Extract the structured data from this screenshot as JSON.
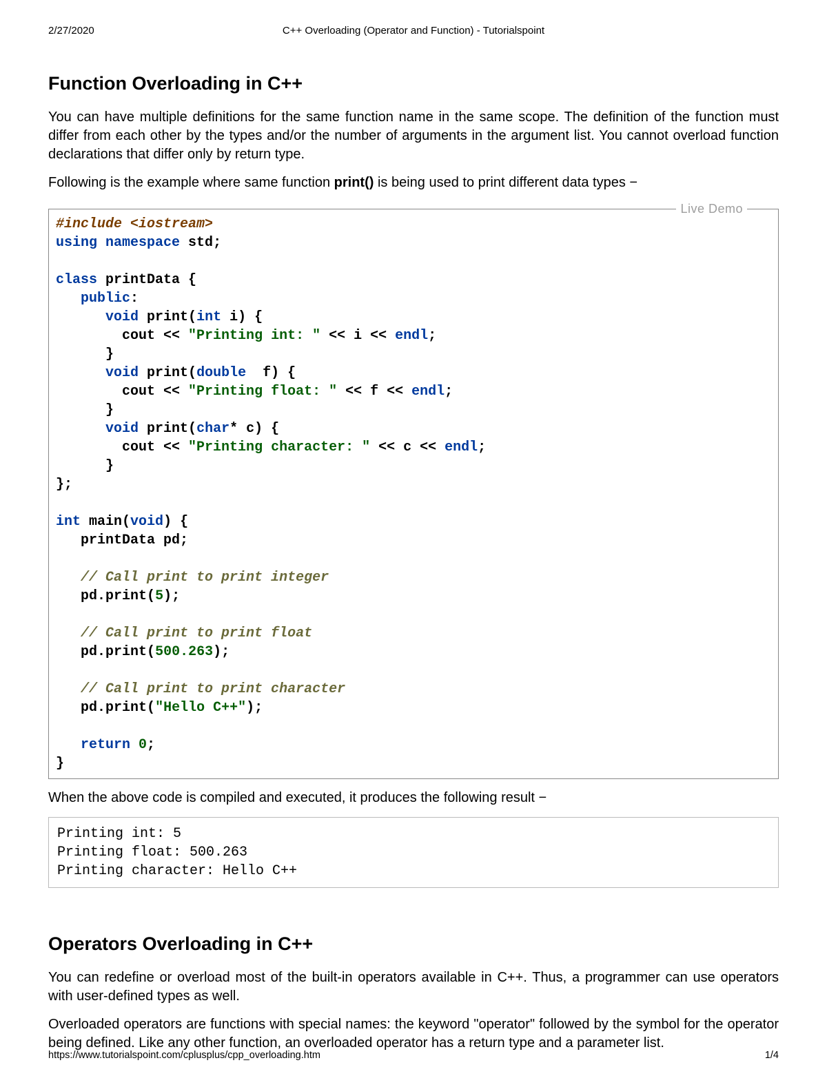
{
  "header": {
    "date": "2/27/2020",
    "title": "C++ Overloading (Operator and Function) - Tutorialspoint"
  },
  "section1": {
    "heading": "Function Overloading in C++",
    "para1": "You can have multiple definitions for the same function name in the same scope. The definition of the function must differ from each other by the types and/or the number of arguments in the argument list. You cannot overload function declarations that differ only by return type.",
    "para2_pre": "Following is the example where same function ",
    "para2_bold": "print()",
    "para2_post": " is being used to print different data types −"
  },
  "code1": {
    "live_demo": "Live Demo",
    "lines": [
      [
        [
          "#include <iostream>",
          "c-prep"
        ]
      ],
      [
        [
          "using ",
          "c-kw"
        ],
        [
          "namespace ",
          "c-kw"
        ],
        [
          "std",
          "c-ident"
        ],
        [
          ";",
          "c-punc"
        ]
      ],
      [
        [
          "",
          ""
        ]
      ],
      [
        [
          "class ",
          "c-kw"
        ],
        [
          "printData ",
          "c-ident"
        ],
        [
          "{",
          "c-punc"
        ]
      ],
      [
        [
          "   ",
          ""
        ],
        [
          "public",
          "c-kw"
        ],
        [
          ":",
          "c-punc"
        ]
      ],
      [
        [
          "      ",
          ""
        ],
        [
          "void ",
          "c-type"
        ],
        [
          "print",
          "c-ident"
        ],
        [
          "(",
          "c-punc"
        ],
        [
          "int ",
          "c-type"
        ],
        [
          "i",
          "c-ident"
        ],
        [
          ") {",
          "c-punc"
        ]
      ],
      [
        [
          "        cout ",
          "c-ident"
        ],
        [
          "<< ",
          "c-op"
        ],
        [
          "\"Printing int: \"",
          "c-str"
        ],
        [
          " << ",
          "c-op"
        ],
        [
          "i ",
          "c-ident"
        ],
        [
          "<< ",
          "c-op"
        ],
        [
          "endl",
          "c-kw"
        ],
        [
          ";",
          "c-punc"
        ]
      ],
      [
        [
          "      }",
          "c-punc"
        ]
      ],
      [
        [
          "      ",
          ""
        ],
        [
          "void ",
          "c-type"
        ],
        [
          "print",
          "c-ident"
        ],
        [
          "(",
          "c-punc"
        ],
        [
          "double  ",
          "c-type"
        ],
        [
          "f",
          "c-ident"
        ],
        [
          ") {",
          "c-punc"
        ]
      ],
      [
        [
          "        cout ",
          "c-ident"
        ],
        [
          "<< ",
          "c-op"
        ],
        [
          "\"Printing float: \"",
          "c-str"
        ],
        [
          " << ",
          "c-op"
        ],
        [
          "f ",
          "c-ident"
        ],
        [
          "<< ",
          "c-op"
        ],
        [
          "endl",
          "c-kw"
        ],
        [
          ";",
          "c-punc"
        ]
      ],
      [
        [
          "      }",
          "c-punc"
        ]
      ],
      [
        [
          "      ",
          ""
        ],
        [
          "void ",
          "c-type"
        ],
        [
          "print",
          "c-ident"
        ],
        [
          "(",
          "c-punc"
        ],
        [
          "char",
          "c-type"
        ],
        [
          "* ",
          "c-op"
        ],
        [
          "c",
          "c-ident"
        ],
        [
          ") {",
          "c-punc"
        ]
      ],
      [
        [
          "        cout ",
          "c-ident"
        ],
        [
          "<< ",
          "c-op"
        ],
        [
          "\"Printing character: \"",
          "c-str"
        ],
        [
          " << ",
          "c-op"
        ],
        [
          "c ",
          "c-ident"
        ],
        [
          "<< ",
          "c-op"
        ],
        [
          "endl",
          "c-kw"
        ],
        [
          ";",
          "c-punc"
        ]
      ],
      [
        [
          "      }",
          "c-punc"
        ]
      ],
      [
        [
          "};",
          "c-punc"
        ]
      ],
      [
        [
          "",
          ""
        ]
      ],
      [
        [
          "int ",
          "c-type"
        ],
        [
          "main",
          "c-ident"
        ],
        [
          "(",
          "c-punc"
        ],
        [
          "void",
          "c-type"
        ],
        [
          ") {",
          "c-punc"
        ]
      ],
      [
        [
          "   printData pd;",
          "c-ident"
        ]
      ],
      [
        [
          "",
          ""
        ]
      ],
      [
        [
          "   ",
          ""
        ],
        [
          "// Call print to print integer",
          "c-cmt"
        ]
      ],
      [
        [
          "   pd",
          "c-ident"
        ],
        [
          ".",
          "c-punc"
        ],
        [
          "print",
          "c-ident"
        ],
        [
          "(",
          "c-punc"
        ],
        [
          "5",
          "c-num"
        ],
        [
          ");",
          "c-punc"
        ]
      ],
      [
        [
          "",
          ""
        ]
      ],
      [
        [
          "   ",
          ""
        ],
        [
          "// Call print to print float",
          "c-cmt"
        ]
      ],
      [
        [
          "   pd",
          "c-ident"
        ],
        [
          ".",
          "c-punc"
        ],
        [
          "print",
          "c-ident"
        ],
        [
          "(",
          "c-punc"
        ],
        [
          "500.263",
          "c-num"
        ],
        [
          ");",
          "c-punc"
        ]
      ],
      [
        [
          "",
          ""
        ]
      ],
      [
        [
          "   ",
          ""
        ],
        [
          "// Call print to print character",
          "c-cmt"
        ]
      ],
      [
        [
          "   pd",
          "c-ident"
        ],
        [
          ".",
          "c-punc"
        ],
        [
          "print",
          "c-ident"
        ],
        [
          "(",
          "c-punc"
        ],
        [
          "\"Hello C++\"",
          "c-str"
        ],
        [
          ");",
          "c-punc"
        ]
      ],
      [
        [
          "",
          ""
        ]
      ],
      [
        [
          "   ",
          ""
        ],
        [
          "return ",
          "c-kw"
        ],
        [
          "0",
          "c-num"
        ],
        [
          ";",
          "c-punc"
        ]
      ],
      [
        [
          "}",
          "c-punc"
        ]
      ]
    ]
  },
  "result_para": "When the above code is compiled and executed, it produces the following result −",
  "output1": "Printing int: 5\nPrinting float: 500.263\nPrinting character: Hello C++",
  "section2": {
    "heading": "Operators Overloading in C++",
    "para1": "You can redefine or overload most of the built-in operators available in C++. Thus, a programmer can use operators with user-defined types as well.",
    "para2": "Overloaded operators are functions with special names: the keyword \"operator\" followed by the symbol for the operator being defined. Like any other function, an overloaded operator has a return type and a parameter list."
  },
  "footer": {
    "url": "https://www.tutorialspoint.com/cplusplus/cpp_overloading.htm",
    "page": "1/4"
  }
}
